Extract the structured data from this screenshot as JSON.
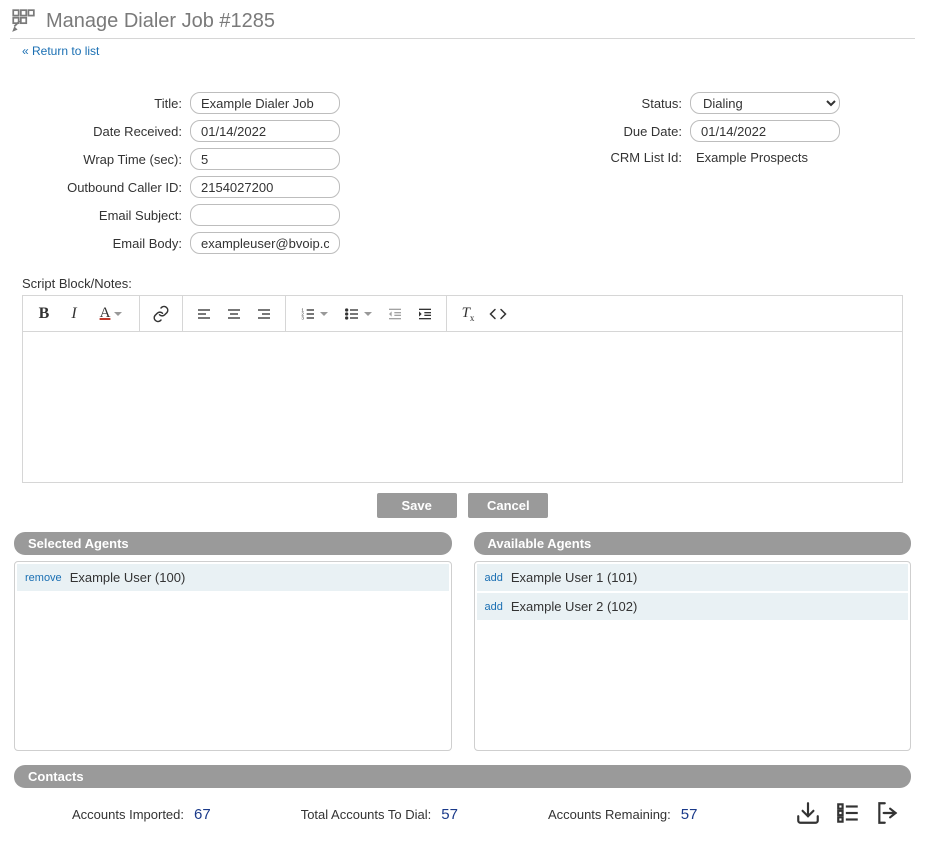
{
  "header": {
    "title": "Manage Dialer Job #1285",
    "return_link": "« Return to list"
  },
  "form": {
    "left": {
      "title_label": "Title:",
      "title_value": "Example Dialer Job",
      "date_received_label": "Date Received:",
      "date_received_value": "01/14/2022",
      "wrap_time_label": "Wrap Time (sec):",
      "wrap_time_value": "5",
      "outbound_caller_label": "Outbound Caller ID:",
      "outbound_caller_value": "2154027200",
      "email_subject_label": "Email Subject:",
      "email_subject_value": "",
      "email_body_label": "Email Body:",
      "email_body_value": "exampleuser@bvoip.com"
    },
    "right": {
      "status_label": "Status:",
      "status_value": "Dialing",
      "due_date_label": "Due Date:",
      "due_date_value": "01/14/2022",
      "crm_list_label": "CRM List Id:",
      "crm_list_value": "Example Prospects"
    }
  },
  "script_block_label": "Script Block/Notes:",
  "buttons": {
    "save": "Save",
    "cancel": "Cancel"
  },
  "selected_agents": {
    "header": "Selected Agents",
    "action": "remove",
    "items": [
      "Example User (100)"
    ]
  },
  "available_agents": {
    "header": "Available Agents",
    "action": "add",
    "items": [
      "Example User 1 (101)",
      "Example User 2 (102)"
    ]
  },
  "contacts": {
    "header": "Contacts",
    "imported_label": "Accounts Imported:",
    "imported_value": "67",
    "todial_label": "Total Accounts To Dial:",
    "todial_value": "57",
    "remaining_label": "Accounts Remaining:",
    "remaining_value": "57"
  }
}
